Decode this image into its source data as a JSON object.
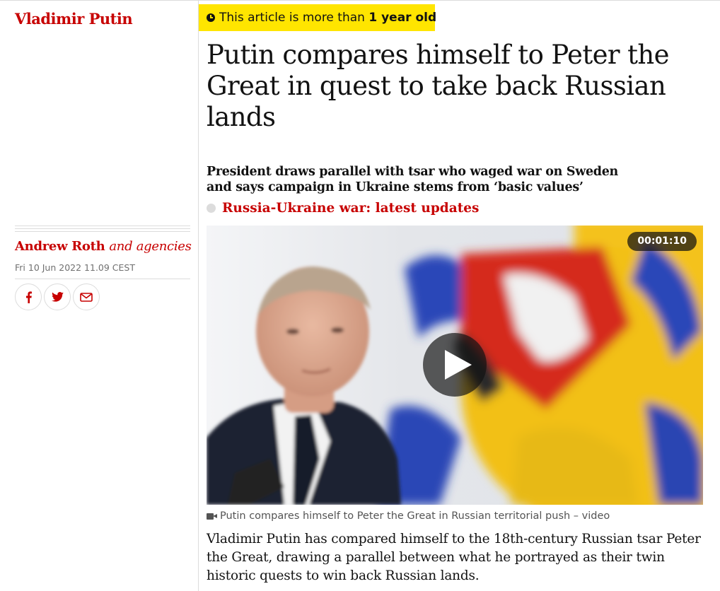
{
  "section": {
    "label": "Vladimir Putin"
  },
  "age_warning": {
    "prefix": "This article is more than ",
    "emphasis": "1 year old"
  },
  "headline": "Putin compares himself to Peter the Great in quest to take back Russian lands",
  "standfirst": "President draws parallel with tsar who waged war on Sweden and says campaign in Ukraine stems from ‘basic values’",
  "live_link": {
    "label": "Russia-Ukraine war: latest updates"
  },
  "byline": {
    "author": "Andrew Roth",
    "extra": "and agencies"
  },
  "dateline": "Fri 10 Jun 2022 11.09 CEST",
  "share": [
    {
      "name": "facebook",
      "icon": "facebook-icon"
    },
    {
      "name": "twitter",
      "icon": "twitter-icon"
    },
    {
      "name": "email",
      "icon": "email-icon"
    }
  ],
  "video": {
    "duration": "00:01:10",
    "caption": "Putin compares himself to Peter the Great in Russian territorial push – video"
  },
  "body": "Vladimir Putin has compared himself to the 18th-century Russian tsar Peter the Great, drawing a parallel between what he portrayed as their twin historic quests to win back Russian lands.",
  "colors": {
    "accent": "#c70000",
    "highlight": "#ffe500",
    "rule": "#dcdcdc",
    "text": "#121212"
  }
}
